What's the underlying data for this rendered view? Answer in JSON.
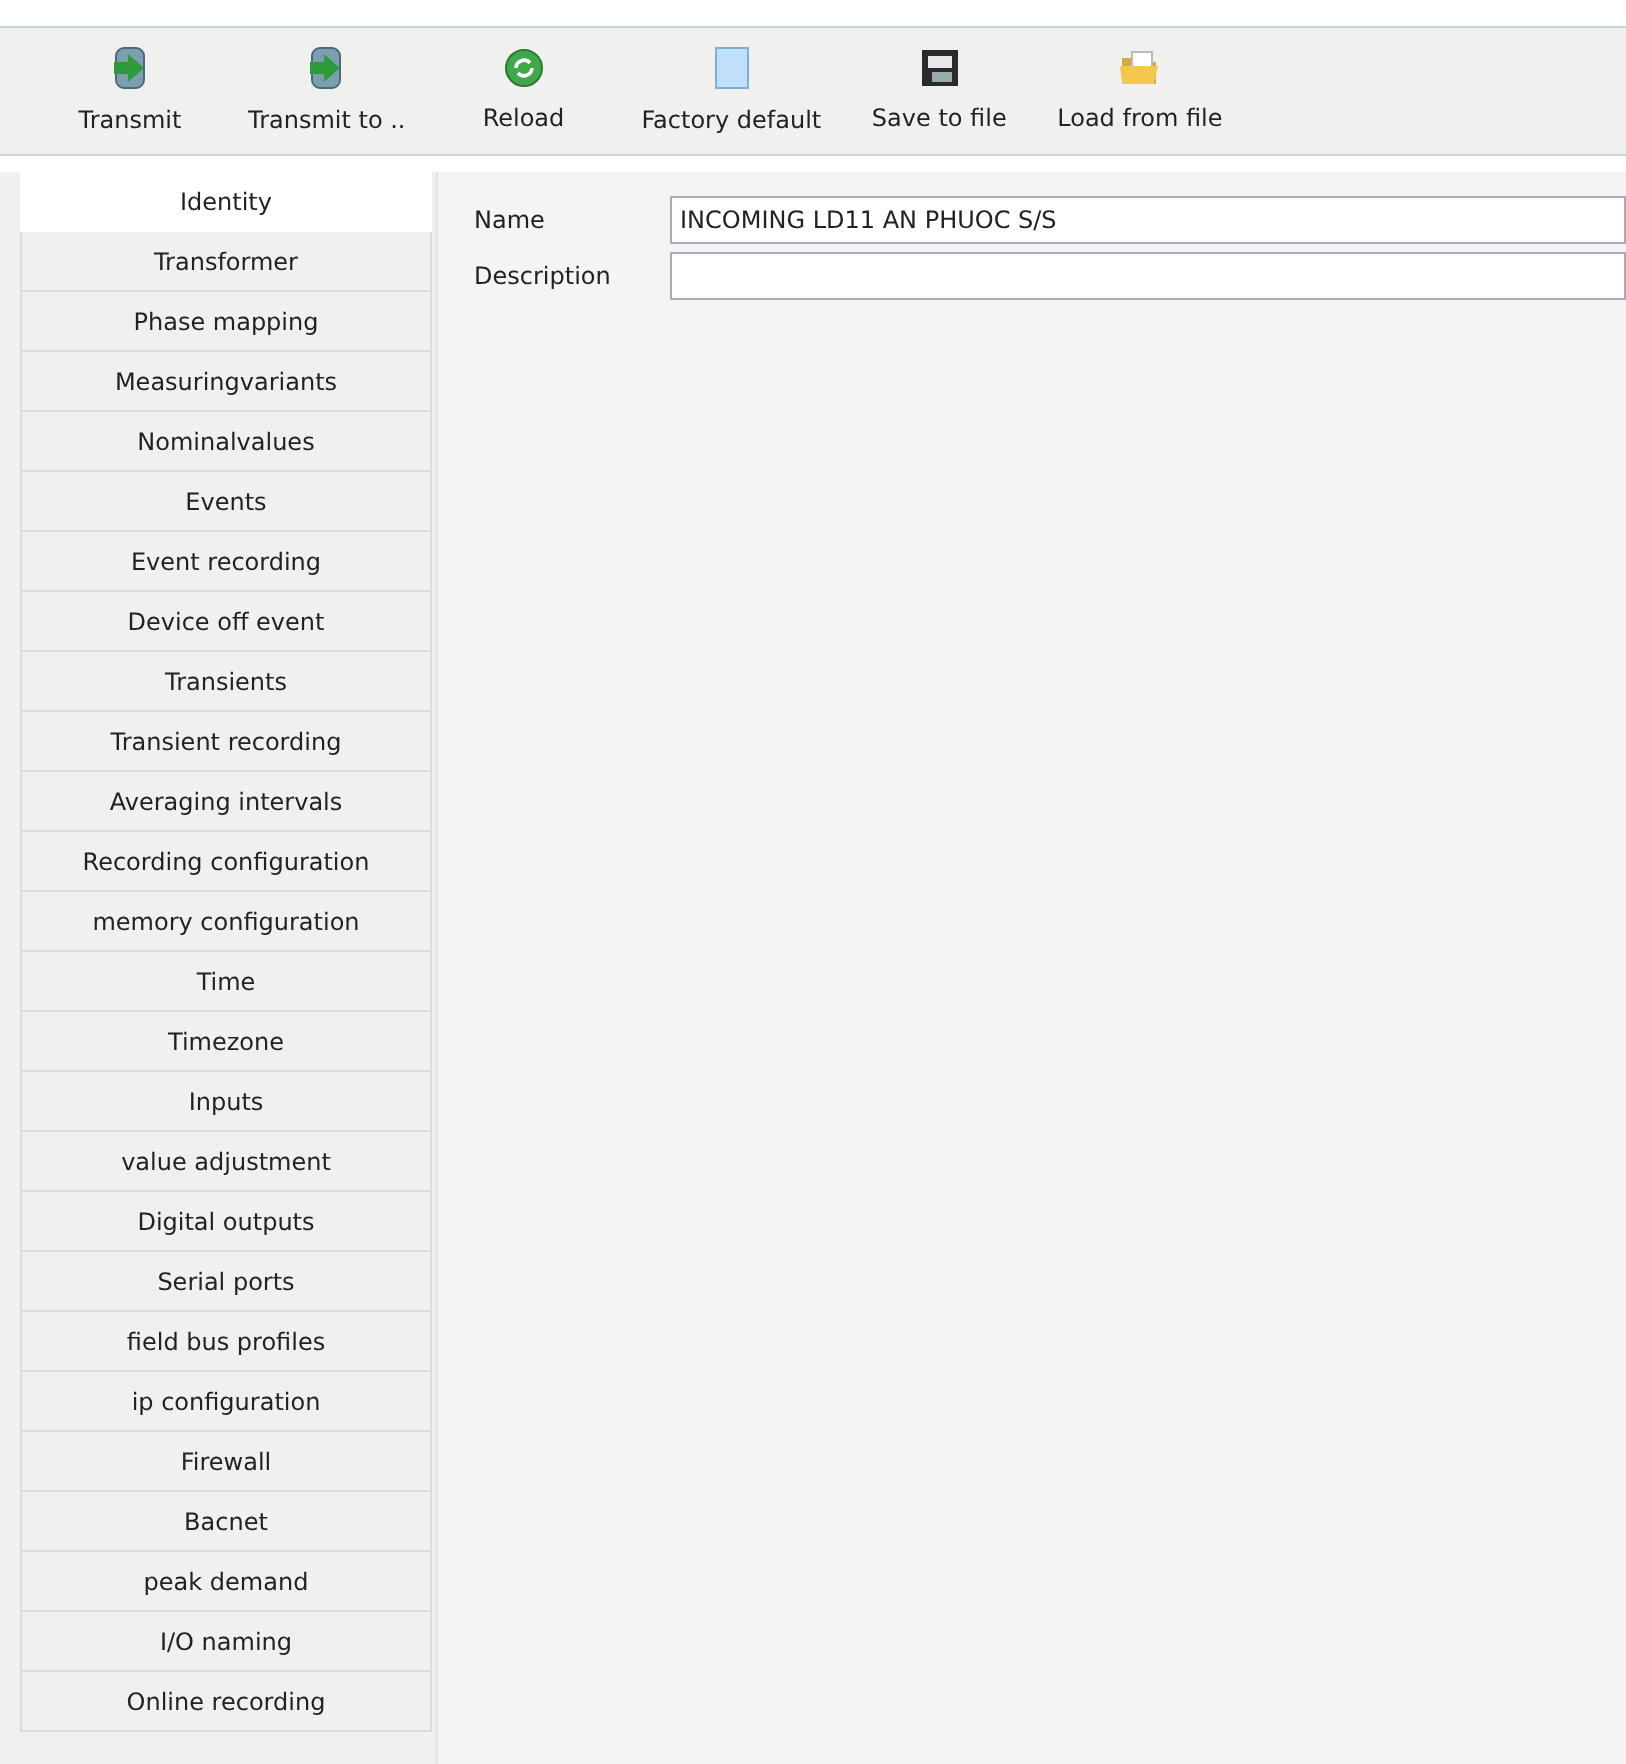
{
  "toolbar": [
    {
      "label": "Transmit",
      "kind": "transmit"
    },
    {
      "label": "Transmit to ..",
      "kind": "transmit"
    },
    {
      "label": "Reload",
      "kind": "reload"
    },
    {
      "label": "Factory default",
      "kind": "page"
    },
    {
      "label": "Save to file",
      "kind": "save"
    },
    {
      "label": "Load from file",
      "kind": "folder"
    }
  ],
  "sidebar": {
    "items": [
      {
        "label": "Identity",
        "selected": true
      },
      {
        "label": "Transformer",
        "selected": false
      },
      {
        "label": "Phase mapping",
        "selected": false
      },
      {
        "label": "Measuringvariants",
        "selected": false
      },
      {
        "label": "Nominalvalues",
        "selected": false
      },
      {
        "label": "Events",
        "selected": false
      },
      {
        "label": "Event recording",
        "selected": false
      },
      {
        "label": "Device off event",
        "selected": false
      },
      {
        "label": "Transients",
        "selected": false
      },
      {
        "label": "Transient recording",
        "selected": false
      },
      {
        "label": "Averaging intervals",
        "selected": false
      },
      {
        "label": "Recording configuration",
        "selected": false
      },
      {
        "label": "memory configuration",
        "selected": false
      },
      {
        "label": "Time",
        "selected": false
      },
      {
        "label": "Timezone",
        "selected": false
      },
      {
        "label": "Inputs",
        "selected": false
      },
      {
        "label": "value adjustment",
        "selected": false
      },
      {
        "label": "Digital outputs",
        "selected": false
      },
      {
        "label": "Serial ports",
        "selected": false
      },
      {
        "label": "field bus profiles",
        "selected": false
      },
      {
        "label": "ip configuration",
        "selected": false
      },
      {
        "label": "Firewall",
        "selected": false
      },
      {
        "label": "Bacnet",
        "selected": false
      },
      {
        "label": "peak demand",
        "selected": false
      },
      {
        "label": "I/O naming",
        "selected": false
      },
      {
        "label": "Online recording",
        "selected": false
      }
    ]
  },
  "form": {
    "fields": [
      {
        "label": "Name",
        "value": "INCOMING LD11 AN PHUOC S/S"
      },
      {
        "label": "Description"
      }
    ]
  }
}
